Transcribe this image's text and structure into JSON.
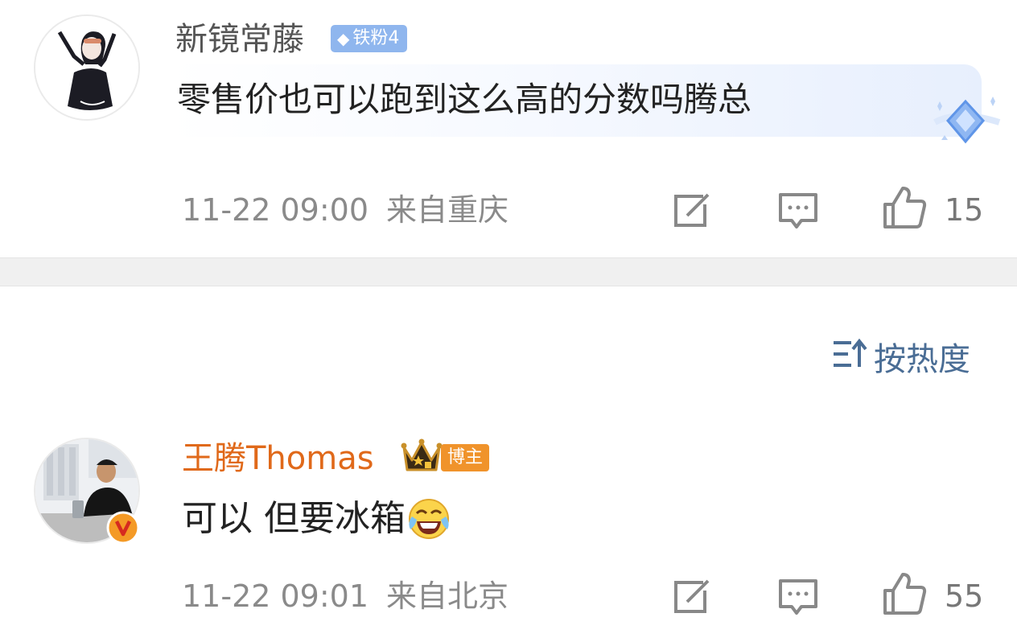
{
  "comments": [
    {
      "username": "新镜常藤",
      "badge": "铁粉4",
      "text": "零售价也可以跑到这么高的分数吗腾总",
      "time": "11-22 09:00",
      "location": "来自重庆",
      "likes": "15"
    },
    {
      "username": "王腾Thomas",
      "badge": "博主",
      "text": "可以 但要冰箱",
      "time": "11-22 09:01",
      "location": "来自北京",
      "likes": "55"
    }
  ],
  "sort": {
    "label": "按热度"
  },
  "icons": {
    "share": "share-icon",
    "comment": "comment-icon",
    "like": "thumbs-up-icon",
    "sort": "sort-icon",
    "verified": "verified-v-icon",
    "emoji": "laughing-tears-emoji",
    "crown": "crown-icon",
    "diamond": "diamond-icon"
  },
  "colors": {
    "username_highlight": "#e0691a",
    "fan_badge": "#8fb6ee",
    "host_badge": "#f0932b",
    "sort_text": "#4a6d95"
  }
}
